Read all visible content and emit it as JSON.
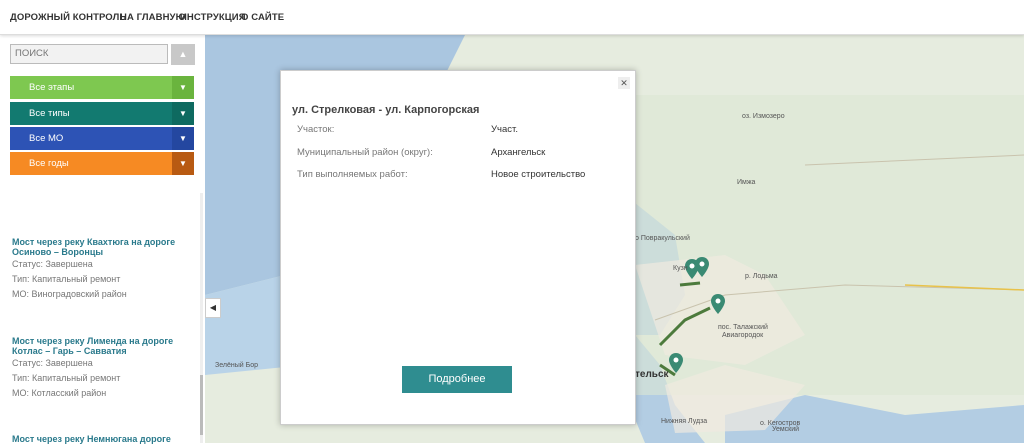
{
  "nav": {
    "items": [
      "ДОРОЖНЫЙ КОНТРОЛЬ",
      "НА ГЛАВНУЮ",
      "ИНСТРУКЦИЯ",
      "О САЙТЕ"
    ]
  },
  "search": {
    "placeholder": "ПОИСК"
  },
  "filters": [
    {
      "label": "Все этапы",
      "color": "#7ec850",
      "btn_color": "#6ab43e"
    },
    {
      "label": "Все типы",
      "color": "#127a70",
      "btn_color": "#0e6a60"
    },
    {
      "label": "Все МО",
      "color": "#2d53b5",
      "btn_color": "#2447a0"
    },
    {
      "label": "Все годы",
      "color": "#f68a23",
      "btn_color": "#b85a12"
    }
  ],
  "list": [
    {
      "title_line1": "Мост через реку Квахтюга на дороге",
      "title_line2": "Осиново – Воронцы",
      "status": "Статус: Завершена",
      "type": "Тип: Капитальный ремонт",
      "mo": "МО: Виноградовский район"
    },
    {
      "title_line1": "Мост через реку Лименда на дороге",
      "title_line2": "Котлас – Гарь – Савватия",
      "status": "Статус: Завершена",
      "type": "Тип: Капитальный ремонт",
      "mo": "МО: Котласский район"
    },
    {
      "title_line1": "Мост через реку Немнюгана дороге"
    }
  ],
  "modal": {
    "title": "ул. Стрелковая - ул. Карпогорская",
    "rows": [
      {
        "label": "Участок:",
        "value": "Участ."
      },
      {
        "label": "Муниципальный район (округ):",
        "value": "Архангельск"
      },
      {
        "label": "Тип выполняемых работ:",
        "value": "Новое строительство"
      }
    ],
    "button": "Подробнее"
  },
  "map_labels": {
    "izmozero": "оз. Измозеро",
    "imya": "Имжа",
    "povrakulsky": "о Повракульский",
    "lodma": "р. Лодьма",
    "talazh": "пос. Талажский",
    "aviagorodok": "Авиагородок",
    "zeleny_bor": "Зелёный Бор",
    "arkhangelsk": "тельск",
    "nizh_ludza": "Нижняя Лудза",
    "ostrov": "о. Кегостров",
    "uemsky": "Уемский",
    "kuzn": "Кузн"
  },
  "colors": {
    "pin": "#3a8a73",
    "route": "#4c7a3c",
    "accent": "#2f8d90"
  },
  "icons": {
    "close": "close-icon",
    "search": "chevron-up-icon",
    "collapse": "chevron-left-icon",
    "filter_caret": "chevron-down-icon",
    "pin": "map-pin-icon"
  }
}
